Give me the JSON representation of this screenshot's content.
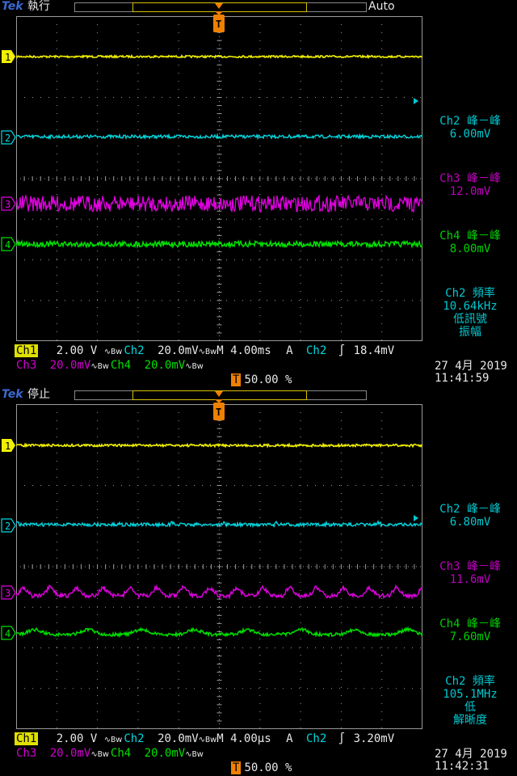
{
  "colors": {
    "ch1": "#f0f000",
    "ch2": "#00d8e0",
    "ch3": "#e000e0",
    "ch4": "#00e000",
    "grid": "#9a9a9a",
    "trigger": "#f08000"
  },
  "screens": [
    {
      "brand": "Tek",
      "state": "執行",
      "mode": "Auto",
      "markers": {
        "ch1": "1",
        "ch2": "2",
        "ch3": "3",
        "ch4": "4",
        "trig": "T"
      },
      "measurements": {
        "ch2_pp_label": "Ch2 峰－峰",
        "ch2_pp_value": "6.00mV",
        "ch3_pp_label": "Ch3 峰－峰",
        "ch3_pp_value": "12.0mV",
        "ch4_pp_label": "Ch4 峰－峰",
        "ch4_pp_value": "8.00mV",
        "freq_lines": [
          "Ch2 頻率",
          "10.64kHz",
          "低訊號",
          "振幅"
        ]
      },
      "status": {
        "ch1_tag": "Ch1",
        "ch1_scale": "2.00 V",
        "ch2_tag": "Ch2",
        "ch2_scale": "20.0mV",
        "ch3_tag": "Ch3",
        "ch3_scale": "20.0mV",
        "ch4_tag": "Ch4",
        "ch4_scale": "20.0mV",
        "bw_mark": "∿B𝗐",
        "timebase": "M 4.00ms",
        "trig_mode": "A",
        "trig_src": "Ch2",
        "trig_slope": "∫",
        "trig_level": "18.4mV",
        "trig_position": "50.00 %",
        "date": "27 4月  2019",
        "time": "11:41:59"
      },
      "waveform_style": "noise"
    },
    {
      "brand": "Tek",
      "state": "停止",
      "mode": "",
      "markers": {
        "ch1": "1",
        "ch2": "2",
        "ch3": "3",
        "ch4": "4",
        "trig": "T"
      },
      "measurements": {
        "ch2_pp_label": "Ch2 峰－峰",
        "ch2_pp_value": "6.80mV",
        "ch3_pp_label": "Ch3 峰－峰",
        "ch3_pp_value": "11.6mV",
        "ch4_pp_label": "Ch4 峰－峰",
        "ch4_pp_value": "7.60mV",
        "freq_lines": [
          "Ch2 頻率",
          "105.1MHz",
          "低",
          "解晰度"
        ]
      },
      "status": {
        "ch1_tag": "Ch1",
        "ch1_scale": "2.00 V",
        "ch2_tag": "Ch2",
        "ch2_scale": "20.0mV",
        "ch3_tag": "Ch3",
        "ch3_scale": "20.0mV",
        "ch4_tag": "Ch4",
        "ch4_scale": "20.0mV",
        "bw_mark": "∿B𝗐",
        "timebase": "M 4.00µs",
        "trig_mode": "A",
        "trig_src": "Ch2",
        "trig_slope": "∫",
        "trig_level": "3.20mV",
        "trig_position": "50.00 %",
        "date": "27 4月  2019",
        "time": "11:42:31"
      },
      "waveform_style": "ripple"
    }
  ]
}
